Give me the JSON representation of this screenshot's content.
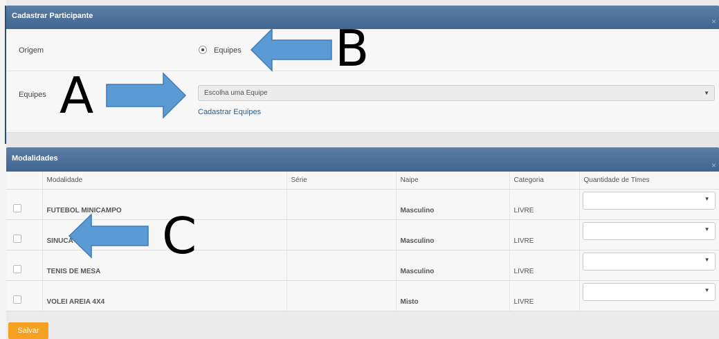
{
  "dialog": {
    "title": "Cadastrar Participante",
    "close_label": "×"
  },
  "origem": {
    "label": "Origem",
    "radio_label": "Equipes"
  },
  "equipes": {
    "label": "Equipes",
    "select_value": "Escolha uma Equipe",
    "link": "Cadastrar Equipes"
  },
  "modalidades": {
    "title": "Modalidades",
    "close_label": "×",
    "columns": [
      "Modalidade",
      "Série",
      "Naipe",
      "Categoria",
      "Quantidade de Times"
    ],
    "rows": [
      {
        "modalidade": "FUTEBOL MINICAMPO",
        "serie": "",
        "naipe": "Masculino",
        "categoria": "LIVRE"
      },
      {
        "modalidade": "SINUCA",
        "serie": "",
        "naipe": "Masculino",
        "categoria": "LIVRE"
      },
      {
        "modalidade": "TENIS DE MESA",
        "serie": "",
        "naipe": "Masculino",
        "categoria": "LIVRE"
      },
      {
        "modalidade": "VOLEI AREIA 4X4",
        "serie": "",
        "naipe": "Misto",
        "categoria": "LIVRE"
      }
    ]
  },
  "save_label": "Salvar",
  "annotations": {
    "a": "A",
    "b": "B",
    "c": "C"
  },
  "colors": {
    "header": "#4a6f99",
    "arrow": "#5b9bd5",
    "save": "#f4a020"
  }
}
